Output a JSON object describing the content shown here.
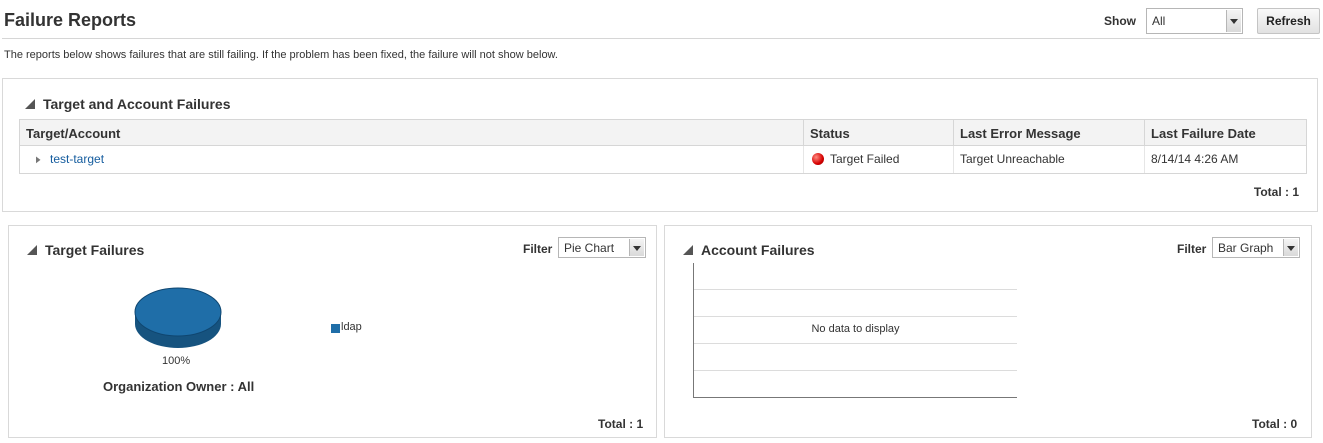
{
  "header": {
    "title": "Failure Reports",
    "show_label": "Show",
    "show_value": "All",
    "refresh_label": "Refresh",
    "intro": "The reports below shows failures that are still failing. If the problem has been fixed, the failure will not show below."
  },
  "failures_panel": {
    "title": "Target and Account Failures",
    "columns": [
      "Target/Account",
      "Status",
      "Last Error Message",
      "Last Failure Date"
    ],
    "rows": [
      {
        "target": "test-target",
        "status": "Target Failed",
        "status_color": "#d50000",
        "message": "Target Unreachable",
        "date": "8/14/14 4:26 AM"
      }
    ],
    "total": "Total : 1"
  },
  "target_failures": {
    "title": "Target Failures",
    "filter_label": "Filter",
    "filter_value": "Pie Chart",
    "legend_label": "ldap",
    "pie_percent": "100%",
    "owner": "Organization Owner : All",
    "total": "Total : 1",
    "chart_data": {
      "type": "pie",
      "slices": [
        {
          "label": "ldap",
          "value": 100
        }
      ],
      "color": "#1f6ea8"
    }
  },
  "account_failures": {
    "title": "Account Failures",
    "filter_label": "Filter",
    "filter_value": "Bar Graph",
    "no_data": "No data to display",
    "total": "Total : 0"
  }
}
